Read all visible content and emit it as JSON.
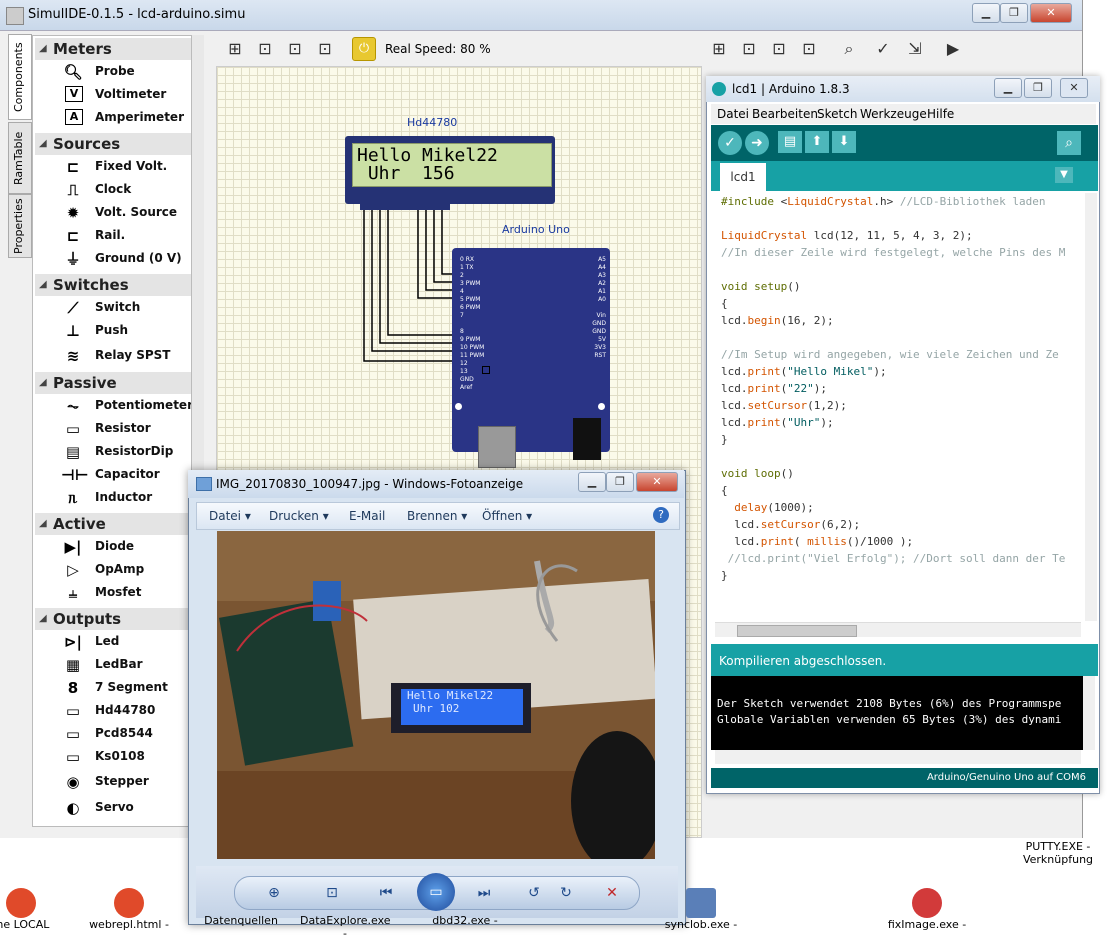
{
  "simulide": {
    "title": "SimulIDE-0.1.5  -  lcd-arduino.simu",
    "side_tabs": [
      "Components",
      "RamTable",
      "Properties"
    ],
    "real_speed": "Real Speed: 80 %",
    "categories": [
      {
        "name": "Meters",
        "items": [
          "Probe",
          "Voltimeter",
          "Amperimeter"
        ]
      },
      {
        "name": "Sources",
        "items": [
          "Fixed Volt.",
          "Clock",
          "Volt. Source",
          "Rail.",
          "Ground (0 V)"
        ]
      },
      {
        "name": "Switches",
        "items": [
          "Switch",
          "Push",
          "Relay SPST"
        ]
      },
      {
        "name": "Passive",
        "items": [
          "Potentiometer",
          "Resistor",
          "ResistorDip",
          "Capacitor",
          "Inductor"
        ]
      },
      {
        "name": "Active",
        "items": [
          "Diode",
          "OpAmp",
          "Mosfet"
        ]
      },
      {
        "name": "Outputs",
        "items": [
          "Led",
          "LedBar",
          "7 Segment",
          "Hd44780",
          "Pcd8544",
          "Ks0108",
          "Stepper",
          "Servo"
        ]
      }
    ],
    "lcd_label": "Hd44780",
    "lcd_line1": "Hello Mikel22",
    "lcd_line2": " Uhr  156",
    "arduino_label": "Arduino Uno",
    "pins_left": [
      "0  RX",
      "1  TX",
      "2",
      "3  PWM",
      "4",
      "5  PWM",
      "6  PWM",
      "7",
      "",
      "8",
      "9  PWM",
      "10 PWM",
      "11 PWM",
      "12",
      "13",
      "GND",
      "Aref"
    ],
    "pins_right": [
      "A5",
      "A4",
      "A3",
      "A2",
      "A1",
      "A0",
      "",
      "Vin",
      "GND",
      "GND",
      "5V",
      "3V3",
      "RST"
    ]
  },
  "ide": {
    "title": "lcd1 | Arduino 1.8.3",
    "menu": [
      "Datei",
      "Bearbeiten",
      "Sketch",
      "Werkzeuge",
      "Hilfe"
    ],
    "tab": "lcd1",
    "status": "Kompilieren abgeschlossen.",
    "console_line1": "Der Sketch verwendet 2108 Bytes (6%) des Programmspe",
    "console_line2": "Globale Variablen verwenden 65 Bytes (3%) des dynami",
    "footer": "Arduino/Genuino Uno auf COM6"
  },
  "viewer": {
    "title": "IMG_20170830_100947.jpg - Windows-Fotoanzeige",
    "menu": [
      "Datei ▾",
      "Drucken ▾",
      "E-Mail",
      "Brennen ▾",
      "Öffnen ▾"
    ],
    "photo_lcd_line1": "Hello Mikel22",
    "photo_lcd_line2": "Uhr  102"
  },
  "desktop": {
    "icons": [
      "me LOCAL",
      "webrepl.html -",
      "Datenquellen",
      "DataExplore.exe -",
      "dbd32.exe -",
      "synclob.exe -",
      "fixImage.exe -"
    ],
    "putty": "PUTTY.EXE -",
    "putty_sub": "Verknüpfung"
  }
}
